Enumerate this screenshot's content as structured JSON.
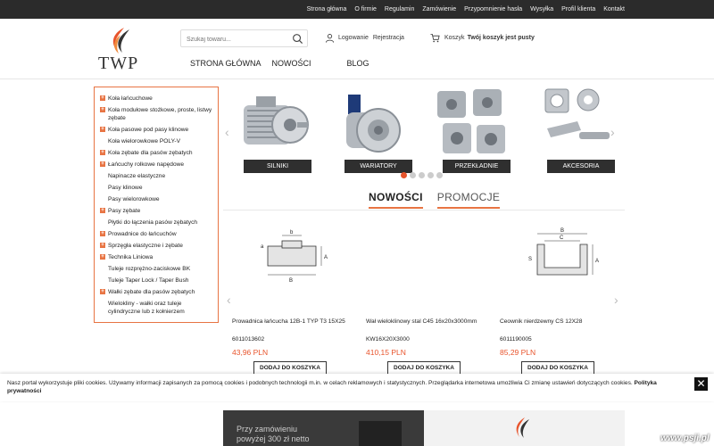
{
  "topnav": [
    "Strona główna",
    "O firmie",
    "Regulamin",
    "Zamówienie",
    "Przypomnienie hasła",
    "Wysyłka",
    "Profil klienta",
    "Kontakt"
  ],
  "logo": {
    "text": "TWP"
  },
  "search": {
    "placeholder": "Szukaj towaru..."
  },
  "account": {
    "login": "Logowanie",
    "register": "Rejestracja"
  },
  "cart": {
    "label": "Koszyk",
    "status": "Twój koszyk jest pusty"
  },
  "mainnav": [
    "STRONA GŁÓWNA",
    "NOWOŚCI",
    "BLOG"
  ],
  "categories": [
    {
      "label": "Koła łańcuchowe",
      "expandable": true
    },
    {
      "label": "Koła modułowe stożkowe, proste, listwy zębate",
      "expandable": true
    },
    {
      "label": "Koła pasowe pod pasy klinowe",
      "expandable": true
    },
    {
      "label": "Koła wielorowkowe POLY-V",
      "expandable": false
    },
    {
      "label": "Koła zębate dla pasów zębatych",
      "expandable": true
    },
    {
      "label": "Łańcuchy rolkowe napędowe",
      "expandable": true
    },
    {
      "label": "Napinacze elastyczne",
      "expandable": false
    },
    {
      "label": "Pasy klinowe",
      "expandable": false
    },
    {
      "label": "Pasy wielorowkowe",
      "expandable": false
    },
    {
      "label": "Pasy zębate",
      "expandable": true
    },
    {
      "label": "Płytki do łączenia pasów zębatych",
      "expandable": false
    },
    {
      "label": "Prowadnice do łańcuchów",
      "expandable": true
    },
    {
      "label": "Sprzęgła elastyczne i zębate",
      "expandable": true
    },
    {
      "label": "Technika Liniowa",
      "expandable": true
    },
    {
      "label": "Tuleje rozprężno-zaciskowe BK",
      "expandable": false
    },
    {
      "label": "Tuleje Taper Lock / Taper Bush",
      "expandable": false
    },
    {
      "label": "Wałki zębate dla pasów zębatych",
      "expandable": true
    },
    {
      "label": "Wielokliny - wałki oraz tuleje cylindryczne lub z kołnierzem",
      "expandable": false
    }
  ],
  "slider": {
    "slides": [
      "SILNIKI",
      "WARIATORY",
      "PRZEKŁADNIE",
      "AKCESORIA"
    ],
    "dots": 5,
    "active_dot": 0
  },
  "tabs": [
    "NOWOŚCI",
    "PROMOCJE"
  ],
  "products": [
    {
      "name": "Prowadnica łańcucha 12B-1 TYP T3 15X25",
      "code": "6011013602",
      "price": "43,96 PLN",
      "button": "DODAJ DO KOSZYKA"
    },
    {
      "name": "Wał wieloklinowy stal C45 16x20x3000mm",
      "code": "KW16X20X3000",
      "price": "410,15 PLN",
      "button": "DODAJ DO KOSZYKA"
    },
    {
      "name": "Ceownik nierdzewny CS 12X28",
      "code": "6011190005",
      "price": "85,29 PLN",
      "button": "DODAJ DO KOSZYKA"
    }
  ],
  "cookie": {
    "text": "Nasz portal wykorzystuje pliki cookies. Używamy informacji zapisanych za pomocą cookies i podobnych technologii m.in. w celach reklamowych i statystycznych. Przeglądarka internetowa umożliwia Ci zmianę ustawień dotyczących cookies. ",
    "link": "Polityka prywatności",
    "close": "✕"
  },
  "banner": {
    "line1": "Przy zamówieniu",
    "line2": "powyżej 300 zł netto"
  },
  "watermark": "www.psji.pl",
  "colors": {
    "accent": "#e87443",
    "topbar": "#2b2b2b",
    "price": "#e8542c"
  }
}
